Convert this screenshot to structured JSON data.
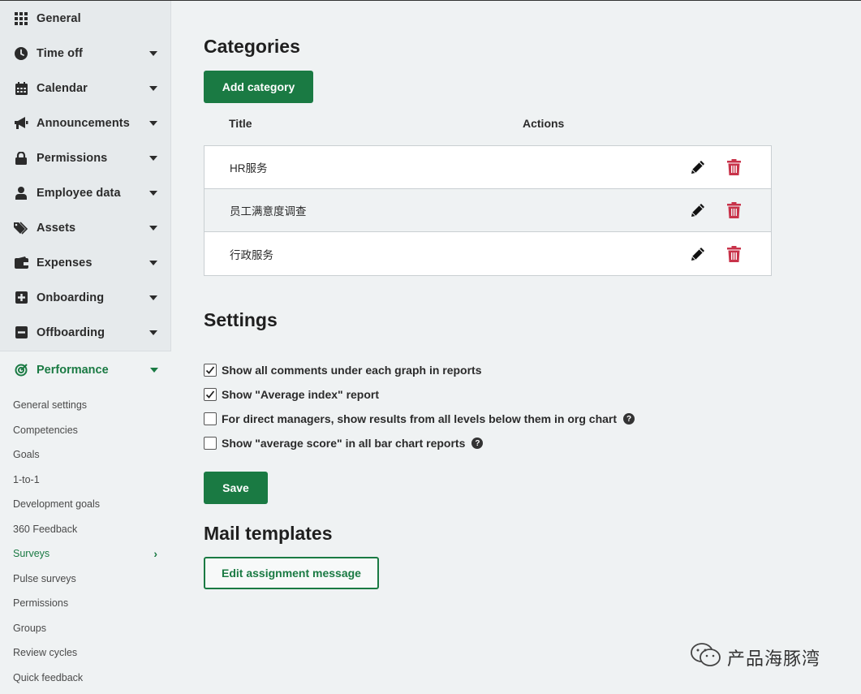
{
  "sidebar": {
    "menu": [
      {
        "label": "General",
        "icon": "grid-icon",
        "caret": false
      },
      {
        "label": "Time off",
        "icon": "clock-icon",
        "caret": true
      },
      {
        "label": "Calendar",
        "icon": "calendar-icon",
        "caret": true
      },
      {
        "label": "Announcements",
        "icon": "megaphone-icon",
        "caret": true
      },
      {
        "label": "Permissions",
        "icon": "lock-icon",
        "caret": true
      },
      {
        "label": "Employee data",
        "icon": "user-icon",
        "caret": true
      },
      {
        "label": "Assets",
        "icon": "tags-icon",
        "caret": true
      },
      {
        "label": "Expenses",
        "icon": "wallet-icon",
        "caret": true
      },
      {
        "label": "Onboarding",
        "icon": "plus-square-icon",
        "caret": true
      },
      {
        "label": "Offboarding",
        "icon": "minus-square-icon",
        "caret": true
      }
    ],
    "performance": {
      "label": "Performance",
      "icon": "target-icon"
    },
    "sub_items": [
      {
        "label": "General settings"
      },
      {
        "label": "Competencies"
      },
      {
        "label": "Goals"
      },
      {
        "label": "1-to-1"
      },
      {
        "label": "Development goals"
      },
      {
        "label": "360 Feedback"
      },
      {
        "label": "Surveys",
        "active": true
      },
      {
        "label": "Pulse surveys"
      },
      {
        "label": "Permissions"
      },
      {
        "label": "Groups"
      },
      {
        "label": "Review cycles"
      },
      {
        "label": "Quick feedback"
      }
    ]
  },
  "categories": {
    "heading": "Categories",
    "add_label": "Add category",
    "col_title": "Title",
    "col_actions": "Actions",
    "rows": [
      {
        "title": "HR服务"
      },
      {
        "title": "员工满意度调查"
      },
      {
        "title": "行政服务"
      }
    ]
  },
  "settings": {
    "heading": "Settings",
    "options": [
      {
        "label": "Show all comments under each graph in reports",
        "checked": true,
        "help": false
      },
      {
        "label": "Show \"Average index\" report",
        "checked": true,
        "help": false
      },
      {
        "label": "For direct managers, show results from all levels below them in org chart",
        "checked": false,
        "help": true
      },
      {
        "label": "Show \"average score\" in all bar chart reports",
        "checked": false,
        "help": true
      }
    ],
    "save_label": "Save"
  },
  "mail": {
    "heading": "Mail templates",
    "edit_label": "Edit assignment message"
  },
  "watermark": {
    "text": "产品海豚湾"
  },
  "colors": {
    "accent": "#1a7a43",
    "delete": "#c8334a",
    "bg": "#eff2f3"
  }
}
